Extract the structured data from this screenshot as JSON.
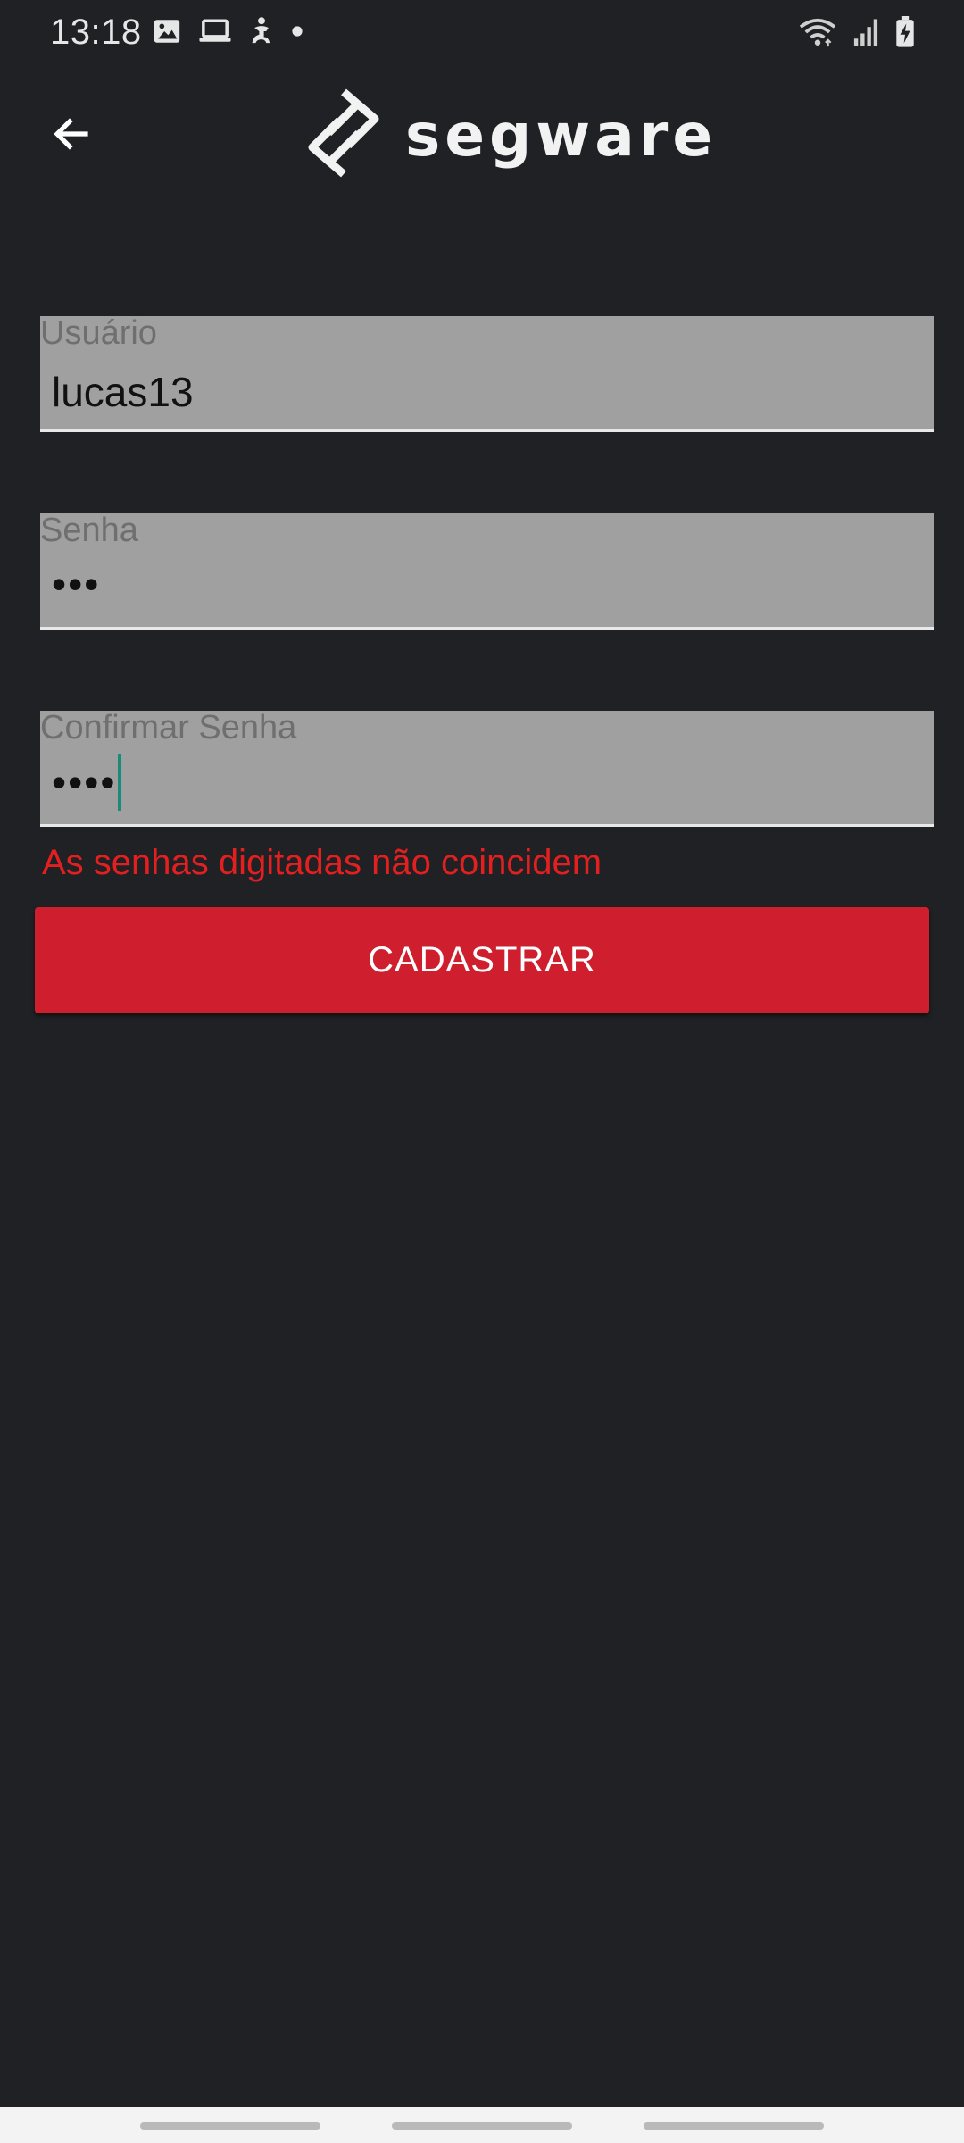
{
  "status_bar": {
    "time": "13:18",
    "left_icons": [
      "image-icon",
      "laptop-icon",
      "accessibility-icon",
      "dot-icon"
    ],
    "right_icons": [
      "wifi-icon",
      "signal-icon",
      "battery-charging-icon"
    ]
  },
  "app_bar": {
    "back_icon": "arrow-back-icon",
    "logo_text": "segware"
  },
  "form": {
    "username": {
      "label": "Usuário",
      "value": "lucas13"
    },
    "password": {
      "label": "Senha",
      "value": "•••"
    },
    "confirm_password": {
      "label": "Confirmar Senha",
      "value": "••••"
    },
    "error_message": "As senhas digitadas não coincidem",
    "submit_label": "CADASTRAR"
  },
  "colors": {
    "background": "#1f2124",
    "field_background": "#a0a0a0",
    "accent_red": "#cf1f2f",
    "error_red": "#e41f1f",
    "caret": "#1a8a7a"
  }
}
